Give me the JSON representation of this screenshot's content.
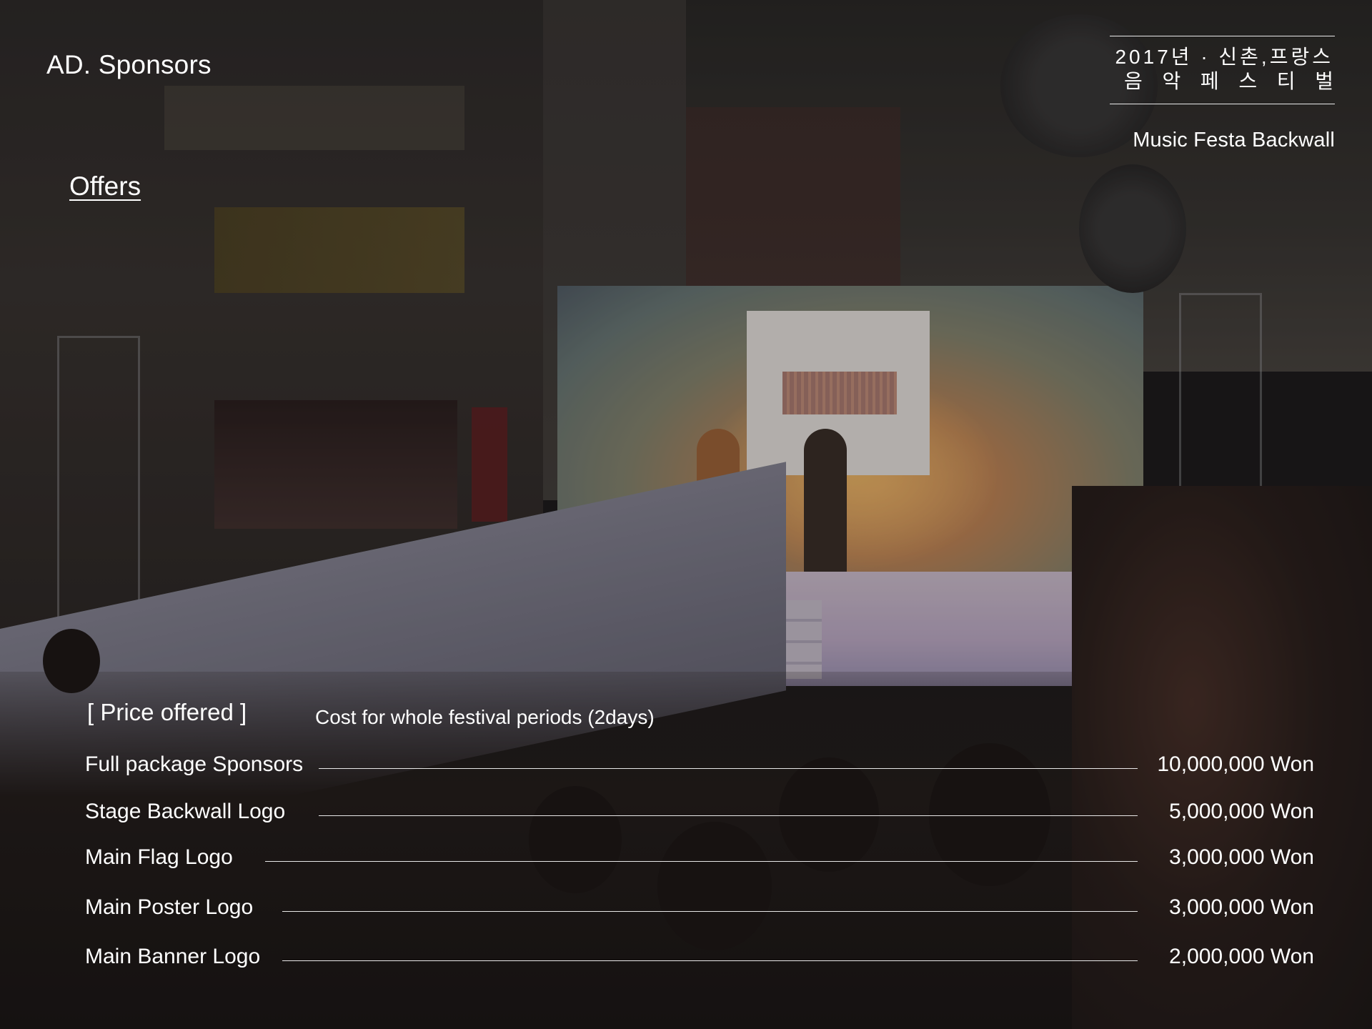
{
  "slide": {
    "section_title": "AD. Sponsors",
    "header": {
      "korean_title_line1": "2017년 · 신촌,프랑스",
      "korean_title_line2": [
        "음",
        "악",
        "페",
        "스",
        "티",
        "벌"
      ],
      "subtitle": "Music Festa Backwall"
    },
    "offers_link": "Offers",
    "price_section": {
      "label": "[ Price offered ]",
      "note": "Cost for whole festival periods (2days)",
      "items": [
        {
          "name": "Full package Sponsors",
          "price": "10,000,000 Won"
        },
        {
          "name": "Stage Backwall Logo",
          "price": "5,000,000 Won"
        },
        {
          "name": "Main Flag Logo",
          "price": "3,000,000 Won"
        },
        {
          "name": "Main Poster Logo",
          "price": "3,000,000 Won"
        },
        {
          "name": "Main Banner Logo",
          "price": "2,000,000 Won"
        }
      ]
    }
  },
  "colors": {
    "text": "#ffffff",
    "overlay_dim": "#0a0a0c"
  }
}
